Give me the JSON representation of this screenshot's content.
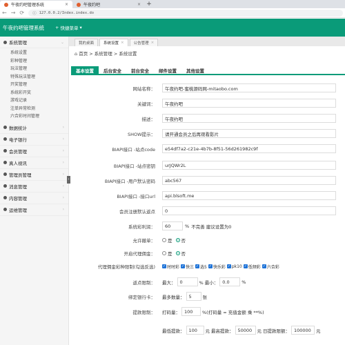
{
  "browser": {
    "tabs": [
      {
        "title": "午夜约吧管理系统",
        "close": "×"
      },
      {
        "title": "午夜约吧",
        "close": "×"
      }
    ],
    "new_tab": "+",
    "url": "127.0.0.2/Index.index.do"
  },
  "app": {
    "title": "午夜约吧管理系统",
    "quick_menu": "快捷菜单"
  },
  "sidebar": {
    "groups": [
      {
        "label": "系统管理",
        "items": [
          "系统设置",
          "彩种管理",
          "玩法管理",
          "特殊玩法管理",
          "开奖管理",
          "系统彩开奖",
          "游戏记录",
          "注单异常检测",
          "六合彩时间管理"
        ]
      },
      {
        "label": "数据统计",
        "items": []
      },
      {
        "label": "电子银行",
        "items": []
      },
      {
        "label": "会员管理",
        "items": []
      },
      {
        "label": "真人视讯",
        "items": []
      },
      {
        "label": "管理员管理",
        "items": []
      },
      {
        "label": "消息管理",
        "items": []
      },
      {
        "label": "内容管理",
        "items": []
      },
      {
        "label": "运维管理",
        "items": []
      }
    ]
  },
  "page_tabs": [
    {
      "label": "我的桌面",
      "close": ""
    },
    {
      "label": "系统设置",
      "close": "×"
    },
    {
      "label": "公告管理",
      "close": "×"
    }
  ],
  "breadcrumb": "首页 > 系统管理 > 系统设置",
  "content_tabs": [
    "基本设置",
    "后台安全",
    "前台安全",
    "邮件设置",
    "其他设置"
  ],
  "form": {
    "site_name": {
      "label": "网站名称：",
      "value": "午夜约吧-蜜桃源码网-mitaobo.com"
    },
    "keywords": {
      "label": "关键词：",
      "value": "午夜约吧"
    },
    "description": {
      "label": "描述：",
      "value": "午夜约吧"
    },
    "show_tip": {
      "label": "SHOW提示：",
      "value": "请开通会员之后再观看影片"
    },
    "biapi_code": {
      "label": "BIAPI接口 -站点code",
      "value": "e54df7a2-c21e-4b7b-8f51-56d261982c9f"
    },
    "biapi_secret": {
      "label": "BIAPI接口 -站点密钥",
      "value": "urJQWr2L"
    },
    "biapi_pwd": {
      "label": "BIAPI接口 -用户默认密码",
      "value": "abc567"
    },
    "biapi_url": {
      "label": "BIAPI接口 -接口url",
      "value": "api.blsoft.me"
    },
    "reg_points": {
      "label": "会员注册默认返点",
      "value": "0"
    },
    "sys_profit": {
      "label": "系统彩利润：",
      "value": "60",
      "unit": "%",
      "hint": "不完善 建议设置为0"
    },
    "allow_cancel": {
      "label": "允许撤单：",
      "opt_yes": "是",
      "opt_no": "否",
      "selected": "否"
    },
    "agent_rebate": {
      "label": "开启代理佣金：",
      "opt_yes": "是",
      "opt_no": "否",
      "selected": "否"
    },
    "agent_lottery": {
      "label": "代理佣金彩种限制(勾选反选)",
      "options": [
        "时时彩",
        "快三",
        "选5",
        "快乐彩",
        "pk10",
        "低频彩",
        "六合彩"
      ]
    },
    "recharge_limit": {
      "label": "返点限制：",
      "max_label": "最大：",
      "max_value": "0",
      "min_label": "% 最小：",
      "min_value": "0.0",
      "unit": "%"
    },
    "bind_card": {
      "label": "绑定银行卡：",
      "prefix": "最多数量：",
      "value": "5",
      "unit": "张"
    },
    "withdraw_limit": {
      "label": "提款限制：",
      "prefix": "打码量：",
      "value": "100",
      "hint": "%(打码量 = 充值金额 乘 **%)"
    },
    "withdraw_amount": {
      "min_label": "最低提款：",
      "min_value": "100",
      "yuan1": "元",
      "max_label": "最高提款：",
      "max_value": "50000",
      "yuan2": "元",
      "day_label": "日提款限额：",
      "day_value": "100000",
      "yuan3": "元"
    }
  }
}
